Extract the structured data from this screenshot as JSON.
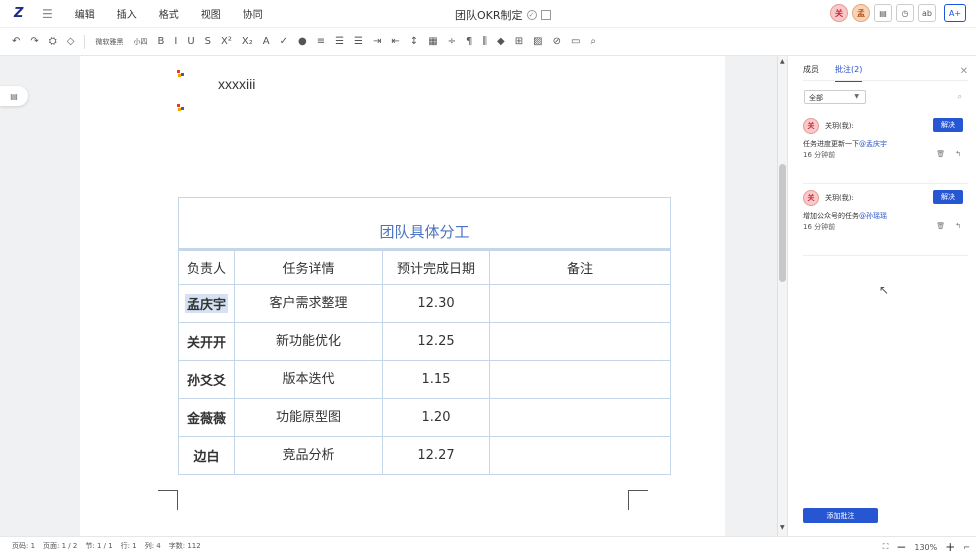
{
  "menubar": {
    "logo": "Z",
    "items": [
      "编辑",
      "插入",
      "格式",
      "视图",
      "协同"
    ],
    "title": "团队OKR制定",
    "avatars": [
      "关",
      "孟"
    ],
    "share_label": "分享"
  },
  "toolbar": {
    "font_name": "微软雅黑",
    "font_size": "小四",
    "buttons": [
      "B",
      "I",
      "U",
      "S",
      "X²",
      "X₂",
      "A",
      "✓"
    ]
  },
  "document": {
    "text_line": "xxxxiii",
    "table": {
      "title": "团队具体分工",
      "headers": [
        "负责人",
        "任务详情",
        "预计完成日期",
        "备注"
      ],
      "rows": [
        {
          "owner": "孟庆宇",
          "task": "客户需求整理",
          "date": "12.30",
          "note": ""
        },
        {
          "owner": "关开开",
          "task": "新功能优化",
          "date": "12.25",
          "note": ""
        },
        {
          "owner": "孙爻爻",
          "task": "版本迭代",
          "date": "1.15",
          "note": ""
        },
        {
          "owner": "金薇薇",
          "task": "功能原型图",
          "date": "1.20",
          "note": ""
        },
        {
          "owner": "边白",
          "task": "竞品分析",
          "date": "12.27",
          "note": ""
        }
      ]
    }
  },
  "panel": {
    "tabs": [
      "成员",
      "批注(2)"
    ],
    "filter": "全部",
    "comments": [
      {
        "avatar": "关",
        "user": "关玥(我):",
        "text_prefix": "任务进度更新一下",
        "mention": "@孟庆宇",
        "time": "16 分钟前",
        "resolve": "解决"
      },
      {
        "avatar": "关",
        "user": "关玥(我):",
        "text_prefix": "增加公众号的任务",
        "mention": "@孙瑶瑶",
        "time": "16 分钟前",
        "resolve": "解决"
      }
    ],
    "add_comment": "添加批注"
  },
  "statusbar": {
    "page_code": "页码: 1",
    "page": "页面: 1 / 2",
    "section": "节: 1 / 1",
    "line": "行: 1",
    "col": "列: 4",
    "words": "字数: 112",
    "zoom": "130%"
  }
}
